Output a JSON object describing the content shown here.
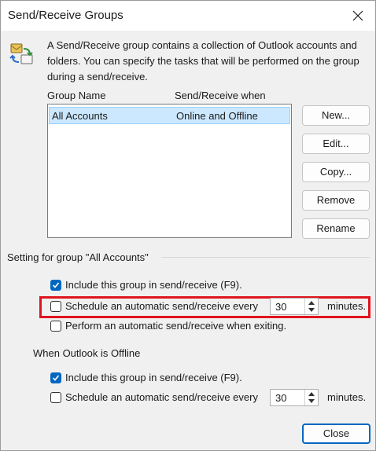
{
  "window": {
    "title": "Send/Receive Groups"
  },
  "description": "A Send/Receive group contains a collection of Outlook accounts and folders. You can specify the tasks that will be performed on the group during a send/receive.",
  "list": {
    "col_group_name": "Group Name",
    "col_when": "Send/Receive when",
    "rows": [
      {
        "name": "All Accounts",
        "when": "Online and Offline",
        "selected": true
      }
    ]
  },
  "buttons": {
    "new": "New...",
    "edit": "Edit...",
    "copy": "Copy...",
    "remove": "Remove",
    "rename": "Rename",
    "close": "Close"
  },
  "setting_group": {
    "label": "Setting for group \"All Accounts\"",
    "include": {
      "label": "Include this group in send/receive (F9).",
      "checked": true
    },
    "schedule": {
      "label": "Schedule an automatic send/receive every",
      "checked": false,
      "value": "30",
      "unit": "minutes."
    },
    "exiting": {
      "label": "Perform an automatic send/receive when exiting.",
      "checked": false
    }
  },
  "offline_group": {
    "label": "When Outlook is Offline",
    "include": {
      "label": "Include this group in send/receive (F9).",
      "checked": true
    },
    "schedule": {
      "label": "Schedule an automatic send/receive every",
      "checked": false,
      "value": "30",
      "unit": "minutes."
    }
  },
  "colors": {
    "accent": "#0067c0",
    "selection": "#cce8ff",
    "highlight_box": "#e0141e"
  }
}
